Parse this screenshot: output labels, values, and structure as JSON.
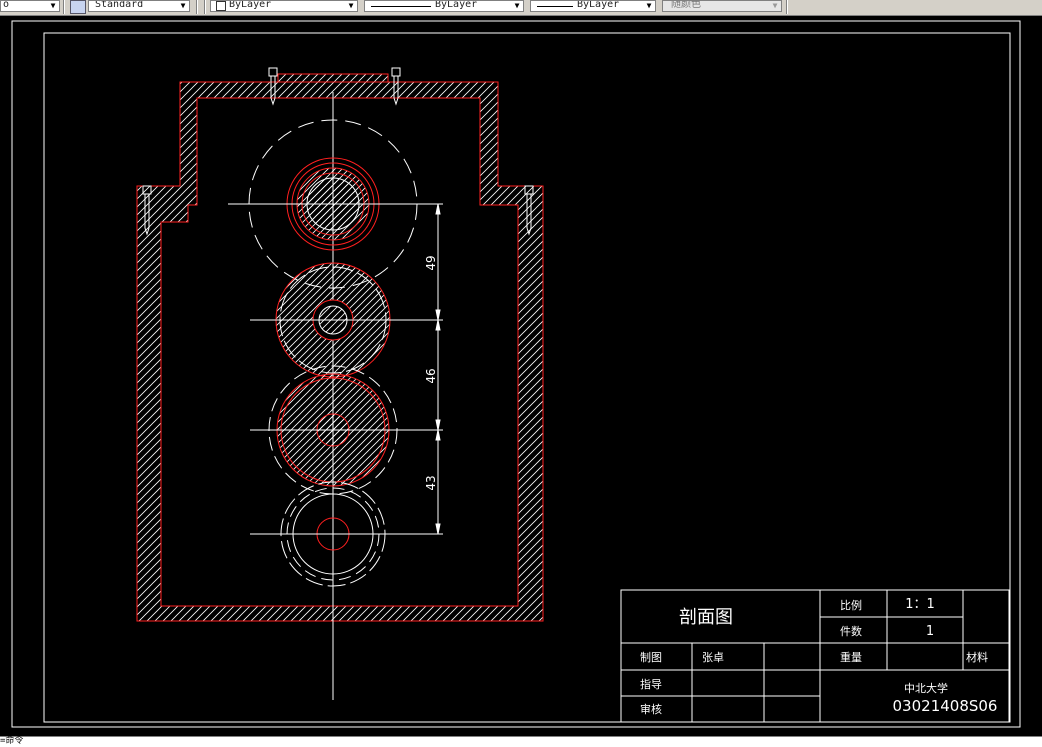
{
  "toolbar": {
    "left_combo_fragment": "o",
    "text_style": "Standard",
    "layer": "ByLayer",
    "linetype": "ByLayer",
    "lineweight": "ByLayer",
    "plot_style": "随颜色"
  },
  "drawing": {
    "dimensions": [
      "49",
      "46",
      "43"
    ]
  },
  "title_block": {
    "drawing_title": "剖面图",
    "scale_label": "比例",
    "scale_value": "1：1",
    "quantity_label": "件数",
    "quantity_value": "1",
    "drawn_label": "制图",
    "drawn_by": "张卓",
    "weight_label": "重量",
    "material_label": "材料",
    "guide_label": "指导",
    "review_label": "审核",
    "university": "中北大学",
    "drawing_number": "03021408S06"
  },
  "command_line": {
    "text": "=命令"
  },
  "colors": {
    "background": "#000000",
    "outline": "#ff2020",
    "lines": "#ffffff",
    "toolbar": "#d4d0c8"
  }
}
